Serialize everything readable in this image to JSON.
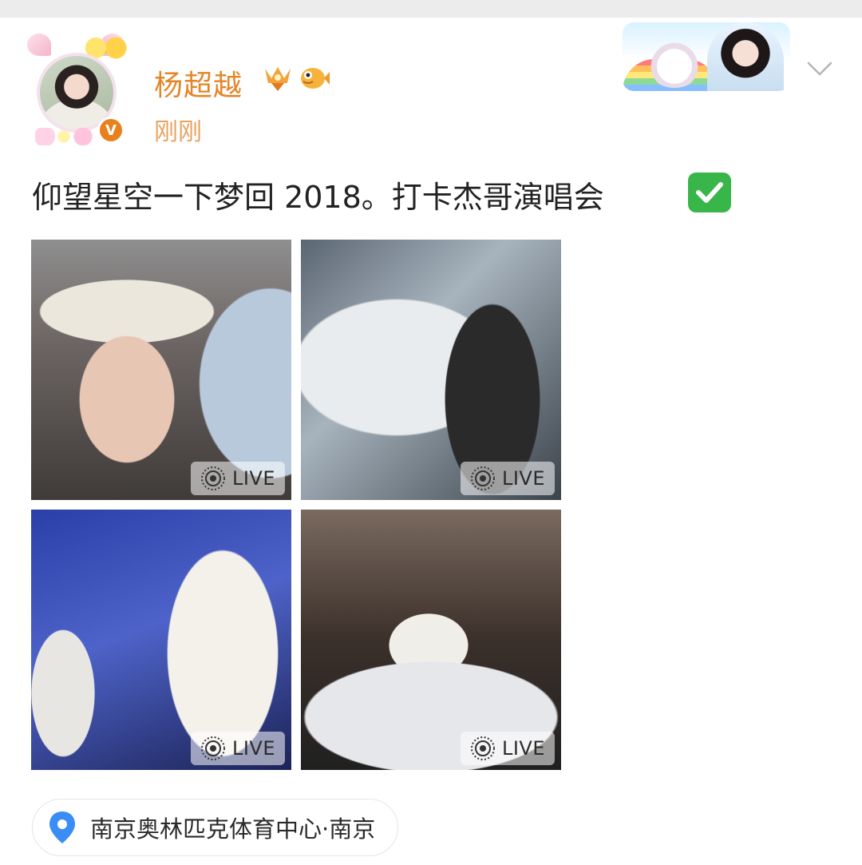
{
  "post": {
    "user_name": "杨超越",
    "time": "刚刚",
    "text": "仰望星空一下梦回 2018。打卡杰哥演唱会",
    "text_emoji_icon": "check-mark-button-icon"
  },
  "photos": [
    {
      "live_label": "LIVE"
    },
    {
      "live_label": "LIVE"
    },
    {
      "live_label": "LIVE"
    },
    {
      "live_label": "LIVE"
    }
  ],
  "location": {
    "place": "南京奥林匹克体育中心",
    "separator": "·",
    "city": "南京"
  },
  "colors": {
    "username": "#e58427",
    "time": "#e8a35e",
    "location_pin": "#3a8df5",
    "check_icon_bg": "#38b64a"
  },
  "icons": [
    "verified-badge-icon",
    "vip-badge-icon",
    "puffer-fish-icon",
    "chevron-down-icon",
    "live-photo-icon",
    "location-pin-icon"
  ]
}
